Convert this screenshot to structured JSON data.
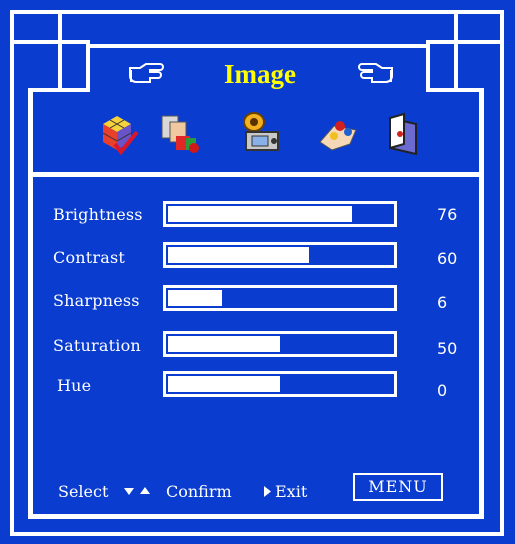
{
  "menu": {
    "title": "Image",
    "icons": [
      "color-cube-icon",
      "geometry-icon",
      "image-camera-icon",
      "hand-settings-icon",
      "exit-door-icon"
    ],
    "selected_icon": "image-camera-icon"
  },
  "rows": [
    {
      "label": "Brightness",
      "value": "76",
      "level": 0.82
    },
    {
      "label": "Contrast",
      "value": "60",
      "level": 0.63
    },
    {
      "label": "Sharpness",
      "value": "6",
      "level": 0.24
    },
    {
      "label": "Saturation",
      "value": "50",
      "level": 0.5
    },
    {
      "label": "Hue",
      "value": "0",
      "level": 0.5
    }
  ],
  "footer": {
    "select": "Select",
    "confirm": "Confirm",
    "exit": "Exit",
    "menu_button": "MENU"
  },
  "colors": {
    "background": "#0a3ccf",
    "frame": "#ffffff",
    "title": "#ffff00"
  }
}
